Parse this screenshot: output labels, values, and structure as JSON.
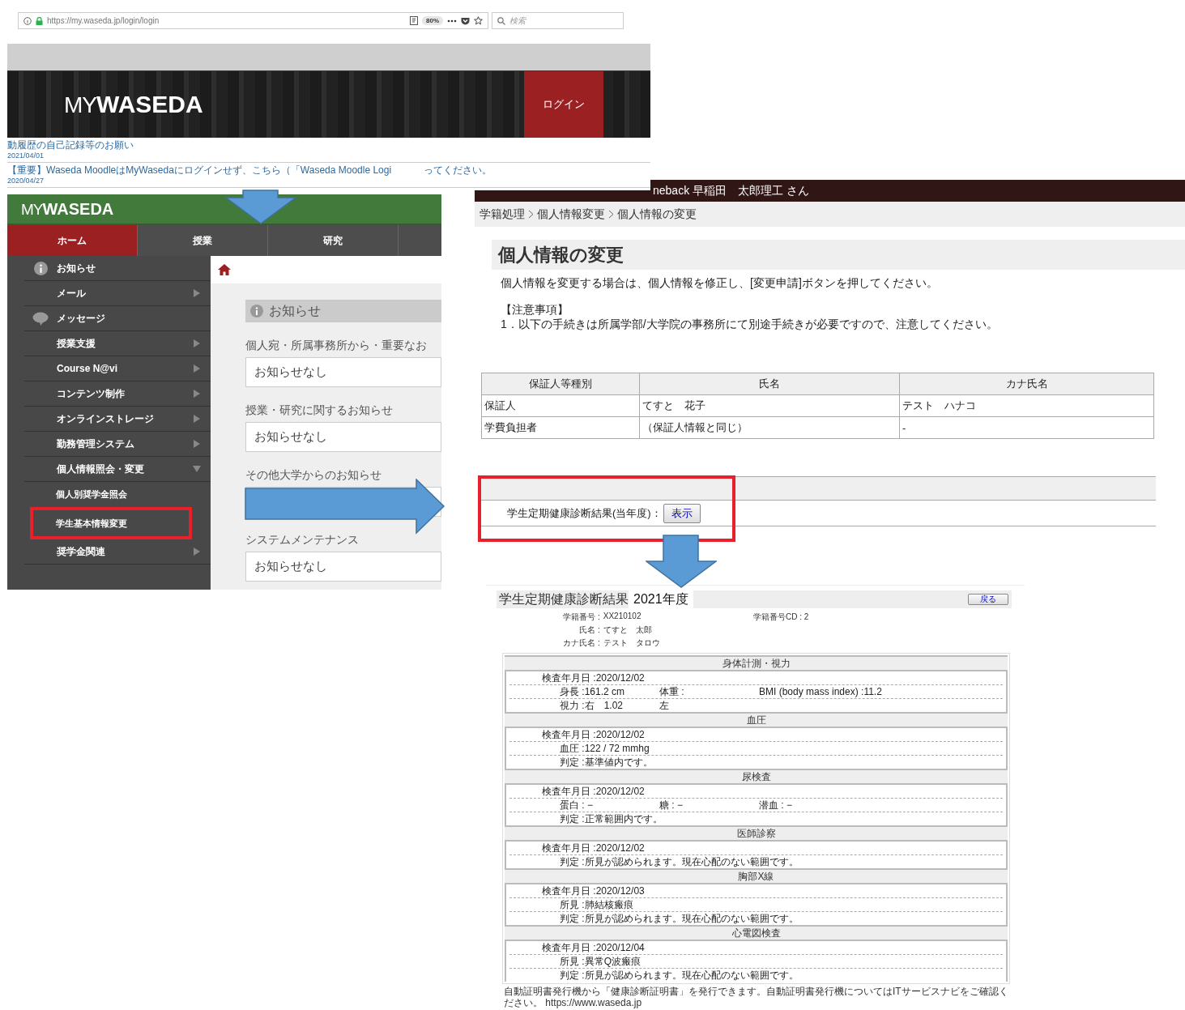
{
  "login_page": {
    "url": "https://my.waseda.jp/login/login",
    "zoom": "80%",
    "search_placeholder": "検索",
    "logo_my": "MY",
    "logo_brand": "WASEDA",
    "login_button": "ログイン",
    "news": [
      {
        "parts": [
          "動履歴の自己記録等のお願い"
        ],
        "date": "2021/04/01"
      },
      {
        "parts": [
          "【重要】Waseda MoodleはMyWasedaにログインせず、こちら（「Waseda Moodle Logi",
          "ってください。"
        ],
        "date": "2020/04/27"
      }
    ]
  },
  "portal": {
    "logo_my": "MY",
    "logo_brand": "WASEDA",
    "tabs": [
      {
        "label": "ホーム",
        "selected": true
      },
      {
        "label": "授業",
        "selected": false
      },
      {
        "label": "研究",
        "selected": false
      }
    ],
    "menu": [
      {
        "kind": "notice",
        "label": "お知らせ"
      },
      {
        "kind": "submenu",
        "label": "メール",
        "expanded": false
      },
      {
        "kind": "message",
        "label": "メッセージ"
      },
      {
        "kind": "submenu",
        "label": "授業支援",
        "expanded": false
      },
      {
        "kind": "submenu",
        "label": "Course N@vi",
        "expanded": false
      },
      {
        "kind": "submenu",
        "label": "コンテンツ制作",
        "expanded": false
      },
      {
        "kind": "submenu",
        "label": "オンラインストレージ",
        "expanded": false
      },
      {
        "kind": "submenu",
        "label": "勤務管理システム",
        "expanded": false
      },
      {
        "kind": "submenu",
        "label": "個人情報照会・変更",
        "expanded": true,
        "children": [
          {
            "label": "個人別奨学金照会",
            "highlighted": false
          },
          {
            "label": "学生基本情報変更",
            "highlighted": true
          }
        ]
      },
      {
        "kind": "submenu",
        "label": "奨学金関連",
        "expanded": false
      }
    ],
    "notice_title": "お知らせ",
    "notice_groups": [
      {
        "title": "個人宛・所属事務所から・重要なお",
        "message": "お知らせなし"
      },
      {
        "title": "授業・研究に関するお知らせ",
        "message": "お知らせなし"
      },
      {
        "title": "その他大学からのお知らせ"
      },
      {
        "title": "システムメンテナンス",
        "message": "お知らせなし"
      }
    ]
  },
  "profile_page": {
    "user_bar": "neback 早稲田　太郎理工 さん",
    "breadcrumb": [
      "学籍処理",
      "個人情報変更",
      "個人情報の変更"
    ],
    "title": "個人情報の変更",
    "intro": "個人情報を変更する場合は、個人情報を修正し、[変更申請]ボタンを押してください。",
    "note_heading": "【注意事項】",
    "note": "1．以下の手続きは所属学部/大学院の事務所にて別途手続きが必要ですので、注意してください。",
    "guardian_table": {
      "columns": [
        "保証人等種別",
        "氏名",
        "カナ氏名"
      ],
      "rows": [
        [
          "保証人",
          "てすと　花子",
          "テスト　ハナコ"
        ],
        [
          "学費負担者",
          "（保証人情報と同じ）",
          "-"
        ]
      ]
    },
    "health_check": {
      "label": "学生定期健康診断結果(当年度)：",
      "button": "表示",
      "highlighted": true
    }
  },
  "health_results": {
    "title": "学生定期健康診断結果",
    "year": "2021年度",
    "back_button": "戻る",
    "info": [
      {
        "label": "学籍番号 :",
        "value": "XX210102"
      },
      {
        "label": "氏名 :",
        "value": "てすと　太郎"
      },
      {
        "label": "カナ氏名 :",
        "value": "テスト　タロウ"
      }
    ],
    "student_cd": "学籍番号CD : 2",
    "sections": [
      {
        "title": "身体計測・視力",
        "rows": [
          {
            "kind": "date",
            "fields": [
              "検査年月日 :2020/12/02"
            ]
          },
          {
            "kind": "item",
            "fields": [
              "身長 :161.2 cm",
              "体重 :",
              "BMI (body mass index) :11.2"
            ]
          },
          {
            "kind": "item",
            "fields": [
              "視力 :右　1.02",
              "左"
            ]
          }
        ]
      },
      {
        "title": "血圧",
        "rows": [
          {
            "kind": "date",
            "fields": [
              "検査年月日 :2020/12/02"
            ]
          },
          {
            "kind": "item",
            "fields": [
              "血圧 :122 / 72 mmhg"
            ]
          },
          {
            "kind": "item",
            "fields": [
              "判定 :基準値内です。"
            ]
          }
        ]
      },
      {
        "title": "尿検査",
        "rows": [
          {
            "kind": "date",
            "fields": [
              "検査年月日 :2020/12/02"
            ]
          },
          {
            "kind": "item",
            "fields": [
              "蛋白 : −",
              "糖 : −",
              "潜血 : −"
            ]
          },
          {
            "kind": "item",
            "fields": [
              "判定 :正常範囲内です。"
            ]
          }
        ]
      },
      {
        "title": "医師診察",
        "rows": [
          {
            "kind": "date",
            "fields": [
              "検査年月日 :2020/12/02"
            ]
          },
          {
            "kind": "item",
            "fields": [
              "判定 :所見が認められます。現在心配のない範囲です。"
            ]
          }
        ]
      },
      {
        "title": "胸部X線",
        "rows": [
          {
            "kind": "date",
            "fields": [
              "検査年月日 :2020/12/03"
            ]
          },
          {
            "kind": "item",
            "fields": [
              "所見 :肺結核瘢痕"
            ]
          },
          {
            "kind": "item",
            "fields": [
              "判定 :所見が認められます。現在心配のない範囲です。"
            ]
          }
        ]
      },
      {
        "title": "心電図検査",
        "rows": [
          {
            "kind": "date",
            "fields": [
              "検査年月日 :2020/12/04"
            ]
          },
          {
            "kind": "item",
            "fields": [
              "所見 :異常Q波瘢痕"
            ]
          },
          {
            "kind": "item",
            "fields": [
              "判定 :所見が認められます。現在心配のない範囲です。"
            ]
          }
        ]
      }
    ],
    "footer": "自動証明書発行機から「健康診断証明書」を発行できます。自動証明書発行機についてはITサービスナビをご確認ください。 https://www.waseda.jp"
  }
}
